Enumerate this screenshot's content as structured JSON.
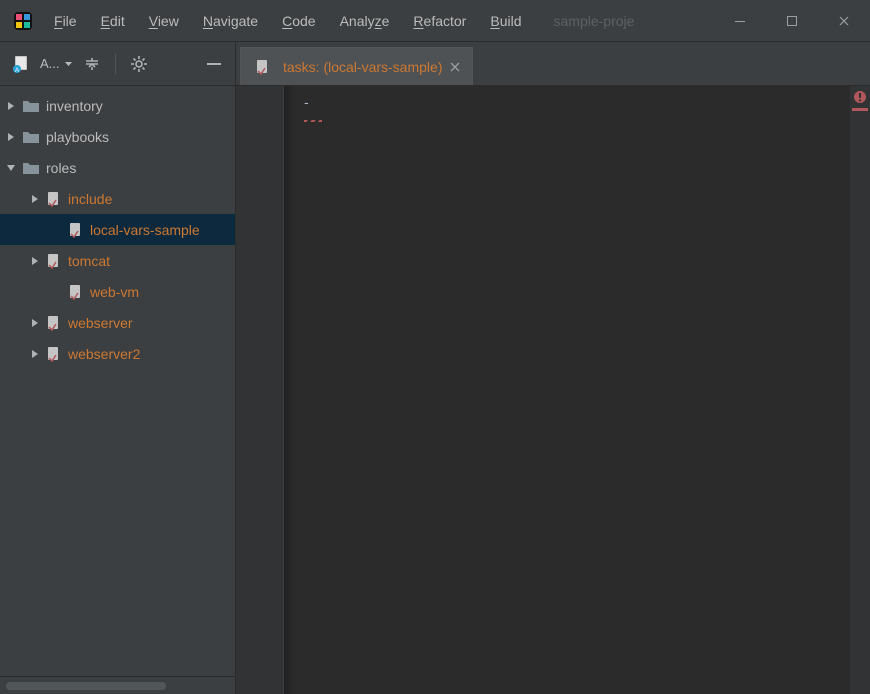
{
  "titlebar": {
    "menu": [
      "File",
      "Edit",
      "View",
      "Navigate",
      "Code",
      "Analyze",
      "Refactor",
      "Build"
    ],
    "project": "sample-proje"
  },
  "sidebar": {
    "selector_label": "A...",
    "tree": {
      "inventory": "inventory",
      "playbooks": "playbooks",
      "roles": "roles",
      "children": {
        "include": "include",
        "local_vars_sample": "local-vars-sample",
        "tomcat": "tomcat",
        "web_vm": "web-vm",
        "webserver": "webserver",
        "webserver2": "webserver2"
      }
    }
  },
  "tabs": {
    "active": {
      "label": "tasks: (local-vars-sample)"
    }
  },
  "editor": {
    "content": "-"
  }
}
